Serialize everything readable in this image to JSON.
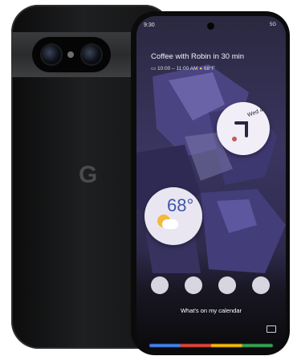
{
  "status": {
    "time": "9:30",
    "network": "5G"
  },
  "event": {
    "title": "Coffee with Robin in 30 min",
    "time": "10:00 – 11:00 AM",
    "temp": "68°F"
  },
  "clock_widget": {
    "date": "Wed 4"
  },
  "weather_widget": {
    "temperature": "68°"
  },
  "assistant": {
    "prompt": "What's on my calendar"
  },
  "back_logo": "G",
  "icons": [
    "g-logo",
    "calendar-icon",
    "sun-icon",
    "keyboard-icon"
  ],
  "colors": {
    "google_blue": "#4285f4",
    "google_red": "#ea4335",
    "google_yellow": "#fbbc05",
    "google_green": "#34a853",
    "weather_sun": "#f4b93a",
    "temp_text": "#3f55a8"
  }
}
